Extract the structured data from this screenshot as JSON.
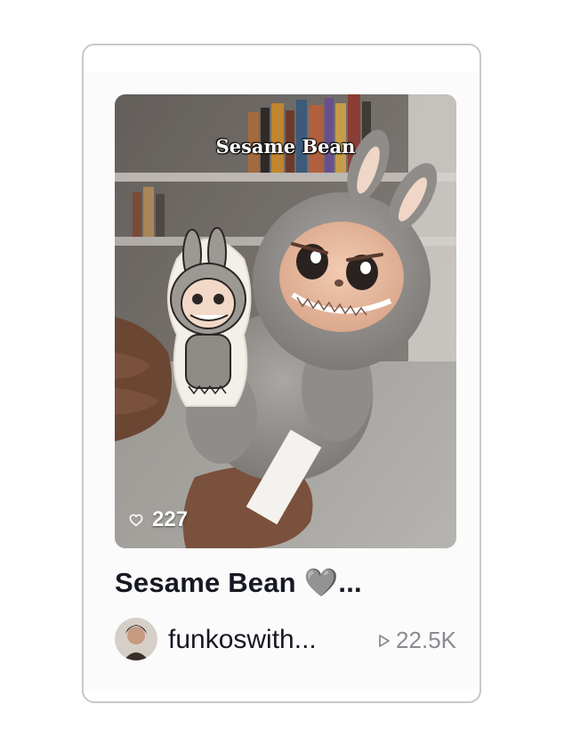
{
  "video": {
    "overlay_title": "Sesame Bean",
    "likes": "227",
    "title": "Sesame Bean 🩶...",
    "author": "funkoswith...",
    "views": "22.5K"
  },
  "icons": {
    "likes": "heart-outline-icon",
    "views": "play-outline-icon"
  },
  "colors": {
    "text_primary": "#161823",
    "text_secondary": "#8a8b91",
    "card_border": "#c9c9c9"
  }
}
